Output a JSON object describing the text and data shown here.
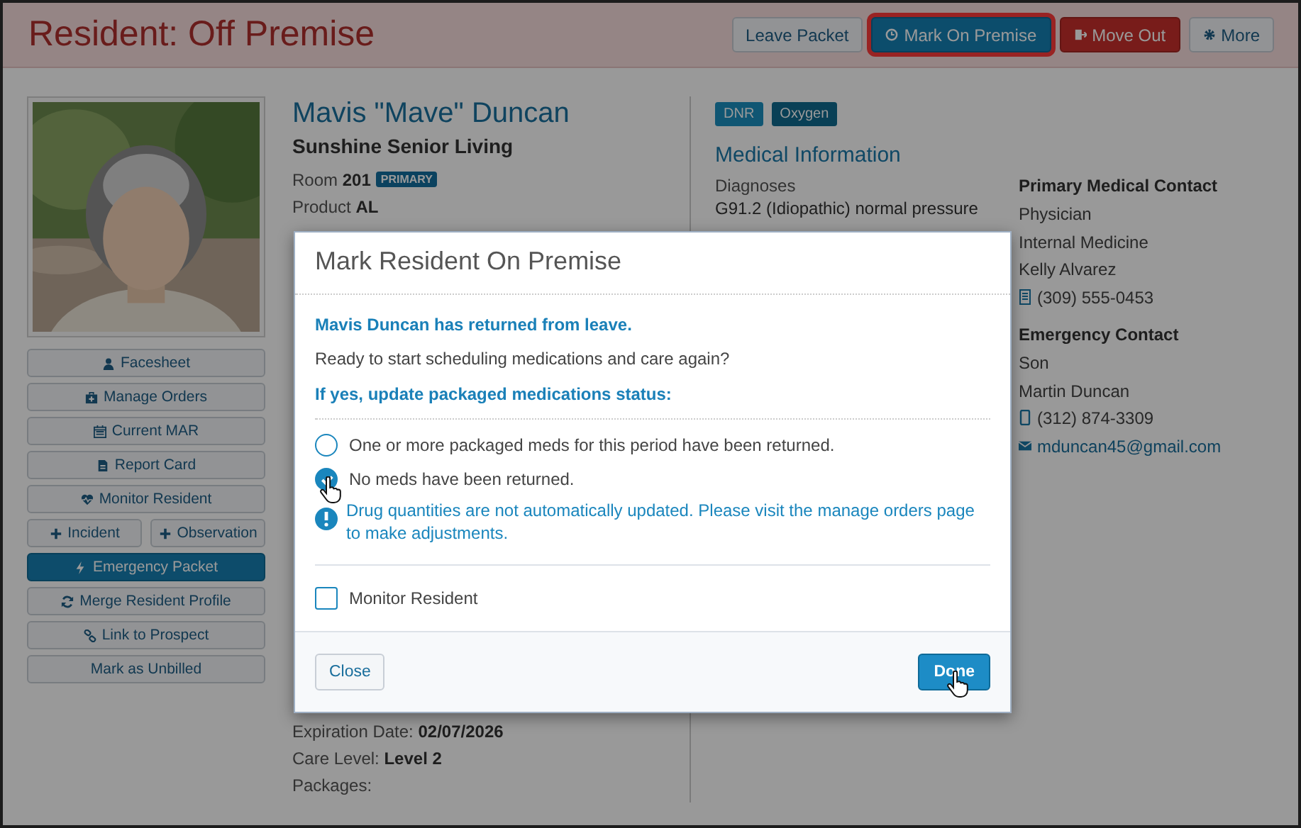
{
  "header": {
    "title": "Resident: Off Premise",
    "actions": [
      {
        "label": "Leave Packet",
        "kind": "default",
        "highlighted": false
      },
      {
        "label": "Mark On Premise",
        "kind": "primary",
        "highlighted": true
      },
      {
        "label": "Move Out",
        "kind": "danger",
        "highlighted": false
      },
      {
        "label": "More",
        "kind": "default",
        "highlighted": false
      }
    ]
  },
  "sidebar_actions": [
    {
      "kind": "button",
      "label": "Facesheet"
    },
    {
      "kind": "button",
      "label": "Manage Orders"
    },
    {
      "kind": "button",
      "label": "Current MAR"
    },
    {
      "kind": "button",
      "label": "Report Card"
    },
    {
      "kind": "button",
      "label": "Monitor Resident"
    },
    {
      "kind": "pair",
      "items": [
        {
          "label": "Incident"
        },
        {
          "label": "Observation"
        }
      ]
    },
    {
      "kind": "primary",
      "label": "Emergency Packet"
    },
    {
      "kind": "button",
      "label": "Merge Resident Profile"
    },
    {
      "kind": "button",
      "label": "Link to Prospect"
    },
    {
      "kind": "button",
      "label": "Mark as Unbilled"
    }
  ],
  "profile": {
    "name": "Mavis \"Mave\" Duncan",
    "facility": "Sunshine Senior Living",
    "fields": [
      {
        "label": "Room",
        "value": "201",
        "badge": "PRIMARY"
      },
      {
        "label": "Product",
        "value": "AL"
      }
    ],
    "lower_fields": [
      {
        "label": "Expiration Date:",
        "value": "02/07/2026"
      },
      {
        "label": "Care Level:",
        "value": "Level 2"
      },
      {
        "label": "Packages:"
      }
    ]
  },
  "tags": [
    {
      "label": "DNR",
      "color": "#105673"
    },
    {
      "label": "Oxygen",
      "color": "#094056"
    }
  ],
  "medical_information": {
    "title": "Medical Information",
    "diagnoses_label": "Diagnoses",
    "diagnoses": "G91.2 (Idiopathic) normal pressure"
  },
  "contacts": [
    {
      "title": "Primary Medical Contact",
      "lines": [
        {
          "kind": "text",
          "text": "Physician"
        },
        {
          "kind": "text",
          "text": "Internal Medicine"
        },
        {
          "kind": "text",
          "text": "Kelly Alvarez"
        },
        {
          "kind": "office_phone",
          "text": "(309) 555-0453"
        }
      ]
    },
    {
      "title": "Emergency Contact",
      "lines": [
        {
          "kind": "text",
          "text": "Son"
        },
        {
          "kind": "text",
          "text": "Martin Duncan"
        },
        {
          "kind": "mobile",
          "text": "(312) 874-3309"
        },
        {
          "kind": "email",
          "text": "mduncan45@gmail.com"
        }
      ]
    }
  ],
  "modal": {
    "title": "Mark Resident On Premise",
    "notice": "Mavis Duncan has returned from leave.",
    "question": "Ready to start scheduling medications and care again?",
    "prompt": "If yes, update packaged medications status:",
    "options": [
      {
        "label": "One or more packaged meds for this period have been returned.",
        "selected": false
      },
      {
        "label": "No meds have been returned.",
        "selected": true
      }
    ],
    "warning": "Drug quantities are not automatically updated. Please visit the manage orders page to make adjustments.",
    "monitor": {
      "label": "Monitor Resident",
      "checked": false
    },
    "close": "Close",
    "done": "Done"
  }
}
